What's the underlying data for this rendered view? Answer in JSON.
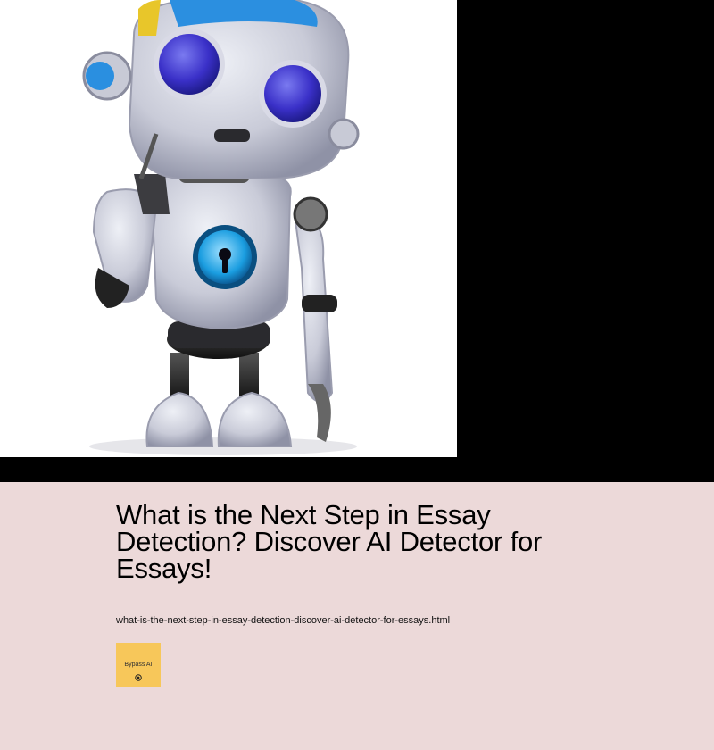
{
  "hero": {
    "image_alt": "robot-illustration"
  },
  "article": {
    "title": "What is the Next Step in Essay Detection? Discover AI Detector for Essays!",
    "url_slug": "what-is-the-next-step-in-essay-detection-discover-ai-detector-for-essays.html"
  },
  "brand": {
    "name": "Bypass AI",
    "icon": "target-icon",
    "color": "#f7c75a"
  },
  "colors": {
    "content_background": "#ecd9d9",
    "hero_background": "#000000"
  }
}
